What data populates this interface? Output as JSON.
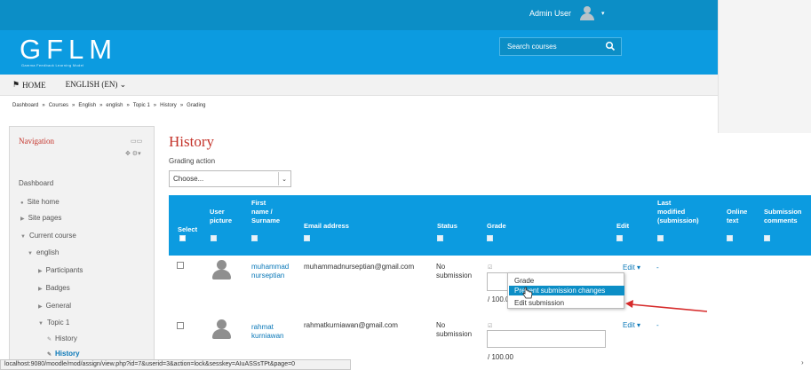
{
  "topbar": {
    "user_name": "Admin User",
    "colors": {
      "bar": "#0c8ec6",
      "header": "#0c9be0"
    }
  },
  "header": {
    "logo": "GFLM",
    "logo_subtitle": "Gamma Feedback Learning Model",
    "search_placeholder": "Search courses"
  },
  "menu": {
    "home": "HOME",
    "language": "ENGLISH (EN)"
  },
  "breadcrumb": [
    "Dashboard",
    "Courses",
    "English",
    "english",
    "Topic 1",
    "History",
    "Grading"
  ],
  "breadcrumb_sep": "»",
  "navigation": {
    "title": "Navigation",
    "items": [
      {
        "label": "Dashboard"
      },
      {
        "label": "Site home"
      },
      {
        "label": "Site pages"
      },
      {
        "label": "Current course"
      },
      {
        "label": "english"
      },
      {
        "label": "Participants"
      },
      {
        "label": "Badges"
      },
      {
        "label": "General"
      },
      {
        "label": "Topic 1"
      },
      {
        "label": "History"
      },
      {
        "label": "History"
      }
    ]
  },
  "main": {
    "title": "History",
    "grading_action_label": "Grading action",
    "grading_action_value": "Choose..."
  },
  "table": {
    "headers": {
      "select": "Select",
      "user_picture": [
        "User",
        "picture"
      ],
      "name": [
        "First",
        "name /",
        "Surname"
      ],
      "email": "Email address",
      "status": "Status",
      "grade": "Grade",
      "edit": "Edit",
      "last_modified": [
        "Last",
        "modified",
        "(submission)"
      ],
      "online_text": [
        "Online",
        "text"
      ],
      "submission_comments": [
        "Submission",
        "comments"
      ]
    },
    "rows": [
      {
        "first": "muhammad",
        "last": "nurseptian",
        "email": "muhammadnurseptian@gmail.com",
        "status": [
          "No",
          "submission"
        ],
        "grade_max": "/ 100.0",
        "edit": "Edit",
        "last_modified": "-"
      },
      {
        "first": "rahmat",
        "last": "kurniawan",
        "email": "rahmatkurniawan@gmail.com",
        "status": [
          "No",
          "submission"
        ],
        "grade_max": "/ 100.00",
        "edit": "Edit",
        "last_modified": "-"
      }
    ]
  },
  "edit_menu": {
    "items": [
      "Grade",
      "Prevent submission changes",
      "Edit submission"
    ],
    "highlighted_index": 1
  },
  "statusbar": {
    "url": "localhost:9080/moodle/mod/assign/view.php?id=7&userid=3&action=lock&sesskey=AIuASSsTPt&page=0"
  }
}
